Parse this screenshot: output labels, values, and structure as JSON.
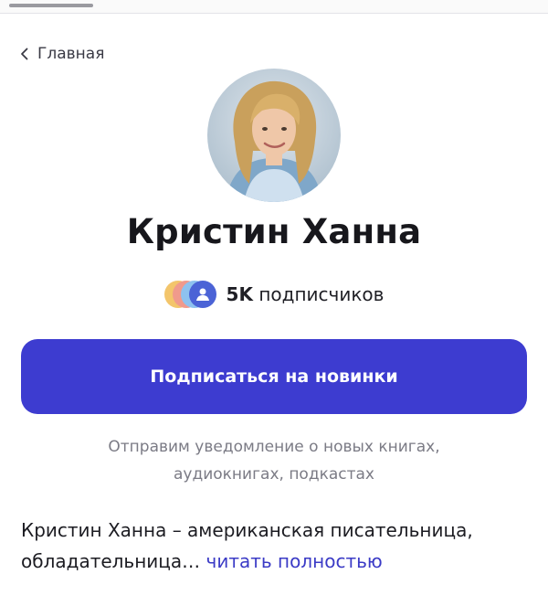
{
  "nav": {
    "back_label": "Главная"
  },
  "author": {
    "name": "Кристин Ханна"
  },
  "subscribers": {
    "count": "5K",
    "label": "подписчиков"
  },
  "subscribe_button": {
    "label": "Подписаться на новинки"
  },
  "notice": {
    "line1": "Отправим уведомление о новых книгах,",
    "line2": "аудиокнигах, подкастах"
  },
  "bio": {
    "text": "Кристин Ханна – американская писательница, обладательница…",
    "read_more": "читать полностью"
  },
  "colors": {
    "accent": "#3d3cd0",
    "link": "#3b3bc6"
  },
  "icons": [
    "chevron-left-icon",
    "author-avatar",
    "subscribers-icons"
  ]
}
